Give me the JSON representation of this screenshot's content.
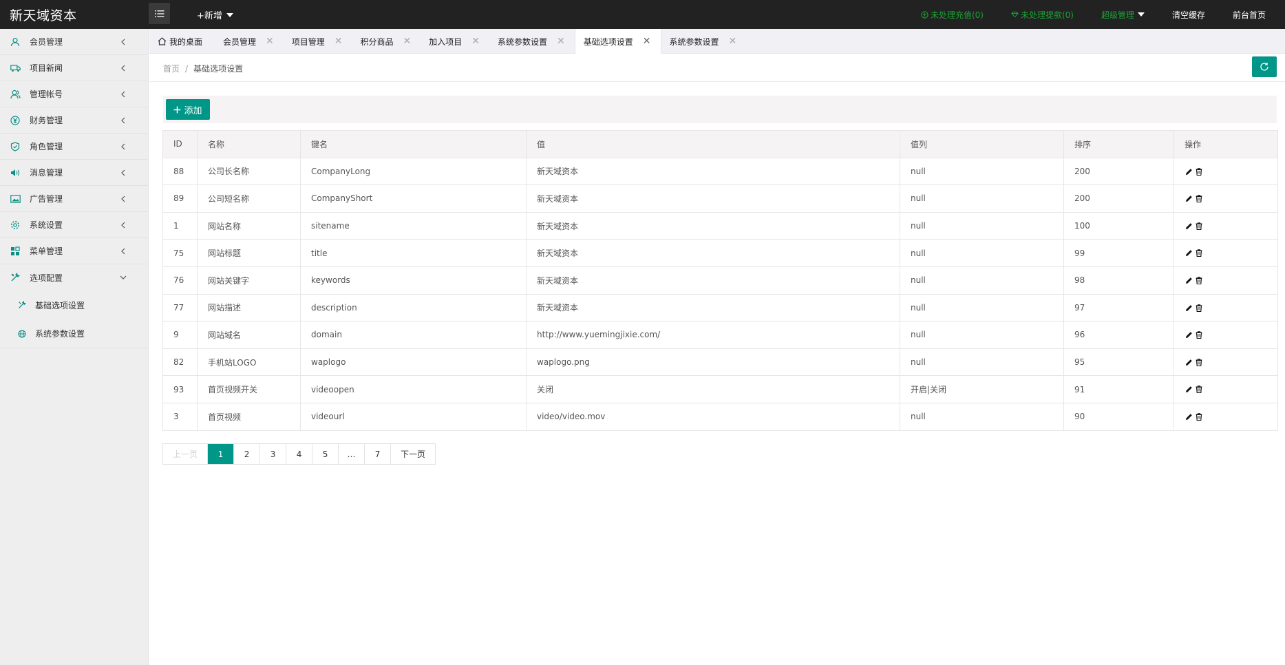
{
  "header": {
    "brand": "新天域资本",
    "add_new": "+新增",
    "right_items": [
      {
        "label": "未处理充值(0)",
        "icon": "plus-circle-icon",
        "color": "#1aa334"
      },
      {
        "label": "未处理提款(0)",
        "icon": "diamond-icon",
        "color": "#1aa334"
      },
      {
        "label": "超级管理",
        "color": "#1aa334"
      },
      {
        "label": "清空缓存",
        "color": "#ffffff"
      },
      {
        "label": "前台首页",
        "color": "#ffffff"
      }
    ]
  },
  "sidebar": {
    "items": [
      {
        "label": "会员管理",
        "icon": "user-icon"
      },
      {
        "label": "项目新闻",
        "icon": "truck-icon"
      },
      {
        "label": "管理帐号",
        "icon": "user-group-icon"
      },
      {
        "label": "财务管理",
        "icon": "yen-icon"
      },
      {
        "label": "角色管理",
        "icon": "shield-check-icon"
      },
      {
        "label": "消息管理",
        "icon": "speaker-icon"
      },
      {
        "label": "广告管理",
        "icon": "image-icon"
      },
      {
        "label": "系统设置",
        "icon": "gear-icon"
      },
      {
        "label": "菜单管理",
        "icon": "apps-icon"
      },
      {
        "label": "选项配置",
        "icon": "tools-icon"
      }
    ],
    "subitems": [
      {
        "label": "基础选项设置",
        "icon": "tools-icon"
      },
      {
        "label": "系统参数设置",
        "icon": "globe-icon"
      }
    ]
  },
  "tabs": [
    {
      "label": "我的桌面"
    },
    {
      "label": "会员管理"
    },
    {
      "label": "项目管理"
    },
    {
      "label": "积分商品"
    },
    {
      "label": "加入项目"
    },
    {
      "label": "系统参数设置"
    },
    {
      "label": "基础选项设置"
    },
    {
      "label": "系统参数设置"
    }
  ],
  "breadcrumb": {
    "home": "首页",
    "sep": "/",
    "current": "基础选项设置"
  },
  "toolbar": {
    "add_label": "添加"
  },
  "table": {
    "headers": [
      "ID",
      "名称",
      "键名",
      "值",
      "值列",
      "排序",
      "操作"
    ],
    "rows": [
      [
        "88",
        "公司长名称",
        "CompanyLong",
        "新天域资本",
        "null",
        "200"
      ],
      [
        "89",
        "公司短名称",
        "CompanyShort",
        "新天域资本",
        "null",
        "200"
      ],
      [
        "1",
        "网站名称",
        "sitename",
        "新天域资本",
        "null",
        "100"
      ],
      [
        "75",
        "网站标题",
        "title",
        "新天域资本",
        "null",
        "99"
      ],
      [
        "76",
        "网站关键字",
        "keywords",
        "新天域资本",
        "null",
        "98"
      ],
      [
        "77",
        "网站描述",
        "description",
        "新天域资本",
        "null",
        "97"
      ],
      [
        "9",
        "网站域名",
        "domain",
        "http://www.yuemingjixie.com/",
        "null",
        "96"
      ],
      [
        "82",
        "手机站LOGO",
        "waplogo",
        "waplogo.png",
        "null",
        "95"
      ],
      [
        "93",
        "首页视频开关",
        "videoopen",
        "关闭",
        "开启|关闭",
        "91"
      ],
      [
        "3",
        "首页视频",
        "videourl",
        "video/video.mov",
        "null",
        "90"
      ]
    ]
  },
  "pagination": {
    "prev": "上一页",
    "pages": [
      "1",
      "2",
      "3",
      "4",
      "5",
      "…",
      "7"
    ],
    "current": "1",
    "next": "下一页"
  },
  "colors": {
    "accent": "#009688",
    "topbar": "#222222",
    "status_green": "#1aa334"
  }
}
